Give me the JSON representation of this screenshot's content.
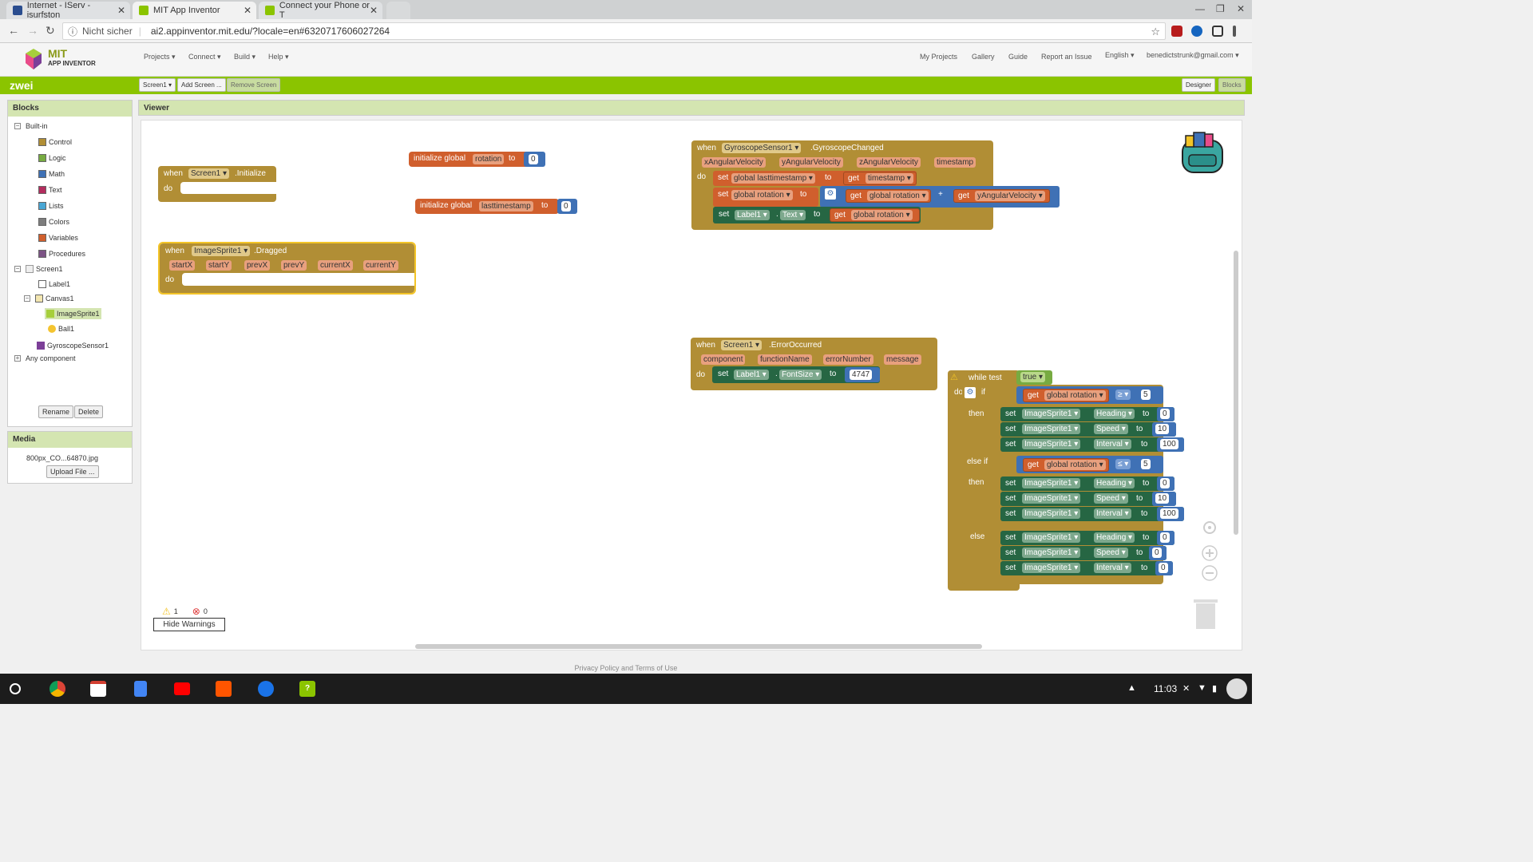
{
  "browser": {
    "tabs": [
      {
        "label": "Internet - IServ - isurfston",
        "close": "✕"
      },
      {
        "label": "MIT App Inventor",
        "close": "✕"
      },
      {
        "label": "Connect your Phone or T",
        "close": "✕"
      }
    ],
    "security": "Nicht sicher",
    "url": "ai2.appinventor.mit.edu/?locale=en#6320717606027264"
  },
  "logo": {
    "line1": "MIT",
    "line2": "APP INVENTOR"
  },
  "topmenu": [
    "Projects ▾",
    "Connect ▾",
    "Build ▾",
    "Help ▾"
  ],
  "rightmenu": [
    "My Projects",
    "Gallery",
    "Guide",
    "Report an Issue",
    "English ▾",
    "benedictstrunk@gmail.com ▾"
  ],
  "project": {
    "name": "zwei",
    "screen_btn": "Screen1 ▾",
    "add_screen": "Add Screen ...",
    "remove_screen": "Remove Screen",
    "designer": "Designer",
    "blocks": "Blocks"
  },
  "blocks_panel": {
    "title": "Blocks",
    "builtin": "Built-in",
    "builtin_items": [
      {
        "label": "Control",
        "color": "#b18e35"
      },
      {
        "label": "Logic",
        "color": "#77ab41"
      },
      {
        "label": "Math",
        "color": "#3f71b5"
      },
      {
        "label": "Text",
        "color": "#b32d5e"
      },
      {
        "label": "Lists",
        "color": "#49a6d4"
      },
      {
        "label": "Colors",
        "color": "#7d7d7d"
      },
      {
        "label": "Variables",
        "color": "#d05f2d"
      },
      {
        "label": "Procedures",
        "color": "#7c5385"
      }
    ],
    "screen": "Screen1",
    "label1": "Label1",
    "canvas": "Canvas1",
    "imagesprite": "ImageSprite1",
    "ball": "Ball1",
    "gyro": "GyroscopeSensor1",
    "any": "Any component",
    "rename": "Rename",
    "delete": "Delete"
  },
  "media": {
    "title": "Media",
    "file": "800px_CO...64870.jpg",
    "upload": "Upload File ..."
  },
  "viewer": {
    "title": "Viewer"
  },
  "warnings": {
    "warn_count": "1",
    "error_count": "0",
    "hide": "Hide Warnings"
  },
  "footer": "Privacy Policy and Terms of Use",
  "clock": "11:03",
  "blocks": {
    "when": "when",
    "do": "do",
    "to": "to",
    "get": "get",
    "set": "set",
    "init_global": "initialize global",
    "screen1": "Screen1 ▾",
    "initialize": ".Initialize",
    "rotation": "rotation",
    "lasttimestamp": "lasttimestamp",
    "zero": "0",
    "imagesprite": "ImageSprite1 ▾",
    "dragged": ".Dragged",
    "drag_params": [
      "startX",
      "startY",
      "prevX",
      "prevY",
      "currentX",
      "currentY"
    ],
    "gyro": "GyroscopeSensor1 ▾",
    "gyro_changed": ".GyroscopeChanged",
    "gyro_params": [
      "xAngularVelocity",
      "yAngularVelocity",
      "zAngularVelocity",
      "timestamp"
    ],
    "global_lasttimestamp": "global lasttimestamp ▾",
    "timestamp_get": "timestamp ▾",
    "global_rotation": "global rotation ▾",
    "yang_get": "yAngularVelocity ▾",
    "plus": "+",
    "label1": "Label1 ▾",
    "text_prop": "Text ▾",
    "fontsize_prop": "FontSize ▾",
    "error_occurred": ".ErrorOccurred",
    "error_params": [
      "component",
      "functionName",
      "errorNumber",
      "message"
    ],
    "fontsize_val": "4747",
    "while_test": "while  test",
    "true_val": "true ▾",
    "if": "if",
    "then": "then",
    "else_if": "else if",
    "else": "else",
    "gte": "≥ ▾",
    "lte": "≤ ▾",
    "five": "5",
    "heading": "Heading ▾",
    "speed": "Speed ▾",
    "interval": "Interval ▾",
    "ten": "10",
    "hundred": "100",
    "dot": "."
  }
}
